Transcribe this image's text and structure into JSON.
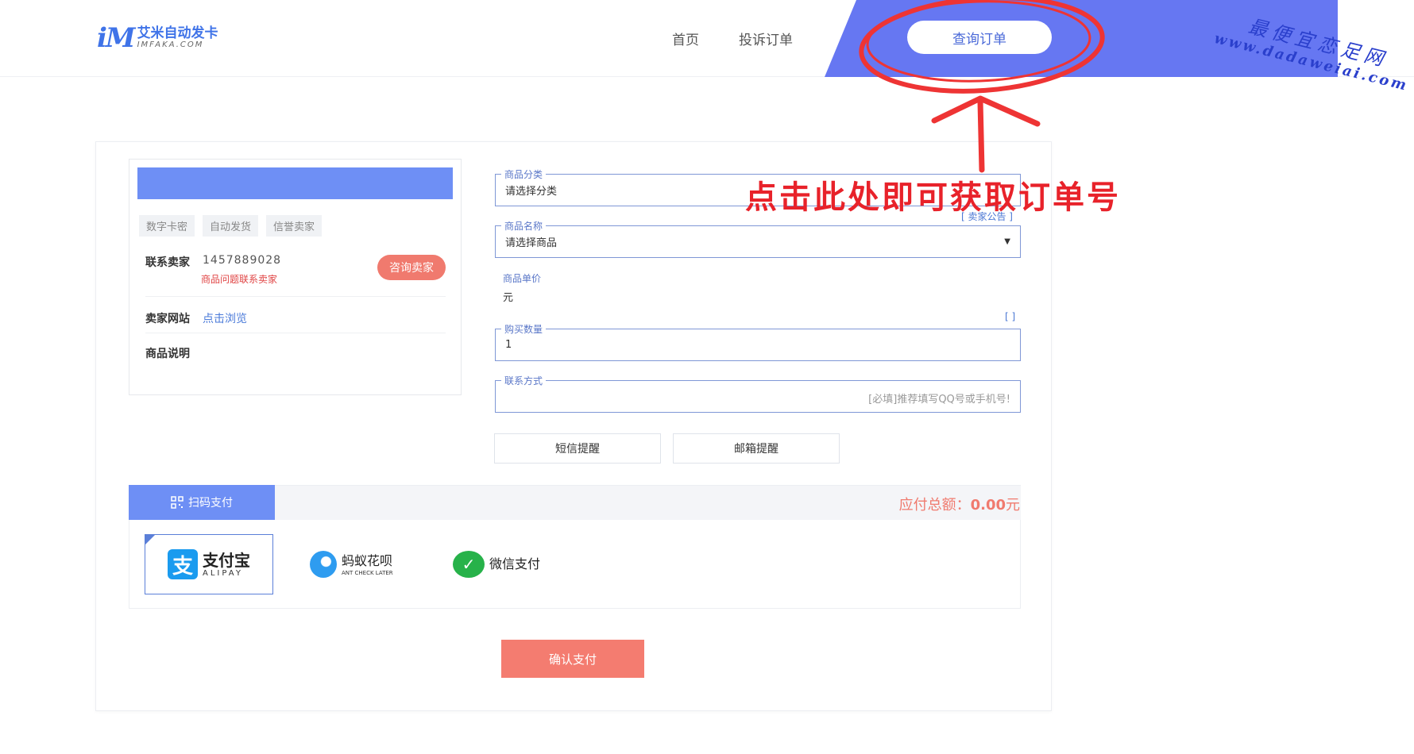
{
  "header": {
    "logo_mark": "iM",
    "logo_cn": "艾米自动发卡",
    "logo_en": "IMFAKA.COM",
    "nav": [
      "首页",
      "投诉订单"
    ],
    "query_button": "查询订单"
  },
  "watermark": {
    "line1": "最便宜恋足网",
    "line2": "www.dadaweiai.com"
  },
  "annotation": {
    "text": "点击此处即可获取订单号",
    "color": "#e8222a"
  },
  "seller": {
    "tags": [
      "数字卡密",
      "自动发货",
      "信誉卖家"
    ],
    "contact_label": "联系卖家",
    "contact_value": "1457889028",
    "contact_hint": "商品问题联系卖家",
    "contact_button": "咨询卖家",
    "site_label": "卖家网站",
    "site_link": "点击浏览",
    "desc_label": "商品说明"
  },
  "form": {
    "category_label": "商品分类",
    "category_value": "请选择分类",
    "notice_link": "[ 卖家公告 ]",
    "product_label": "商品名称",
    "product_value": "请选择商品",
    "price_label": "商品单价",
    "price_value": "元",
    "qty_bracket": "[ ]",
    "qty_label": "购买数量",
    "qty_value": "1",
    "contact_label": "联系方式",
    "contact_placeholder": "[必填]推荐填写QQ号或手机号!",
    "sms_button": "短信提醒",
    "email_button": "邮箱提醒"
  },
  "payment": {
    "tab_label": "扫码支付",
    "total_label": "应付总额：",
    "total_value": "0.00",
    "total_unit": "元",
    "options": [
      {
        "name": "支付宝",
        "sub": "ALIPAY",
        "icon": "alipay-icon"
      },
      {
        "name": "蚂蚁花呗",
        "sub": "ANT CHECK LATER",
        "icon": "ant-check-later-icon"
      },
      {
        "name": "微信支付",
        "sub": "",
        "icon": "wechat-pay-icon"
      }
    ],
    "confirm_button": "确认支付"
  },
  "colors": {
    "accent": "#6e8ff5",
    "header_band": "#6677f2",
    "button_coral": "#f47c70"
  }
}
